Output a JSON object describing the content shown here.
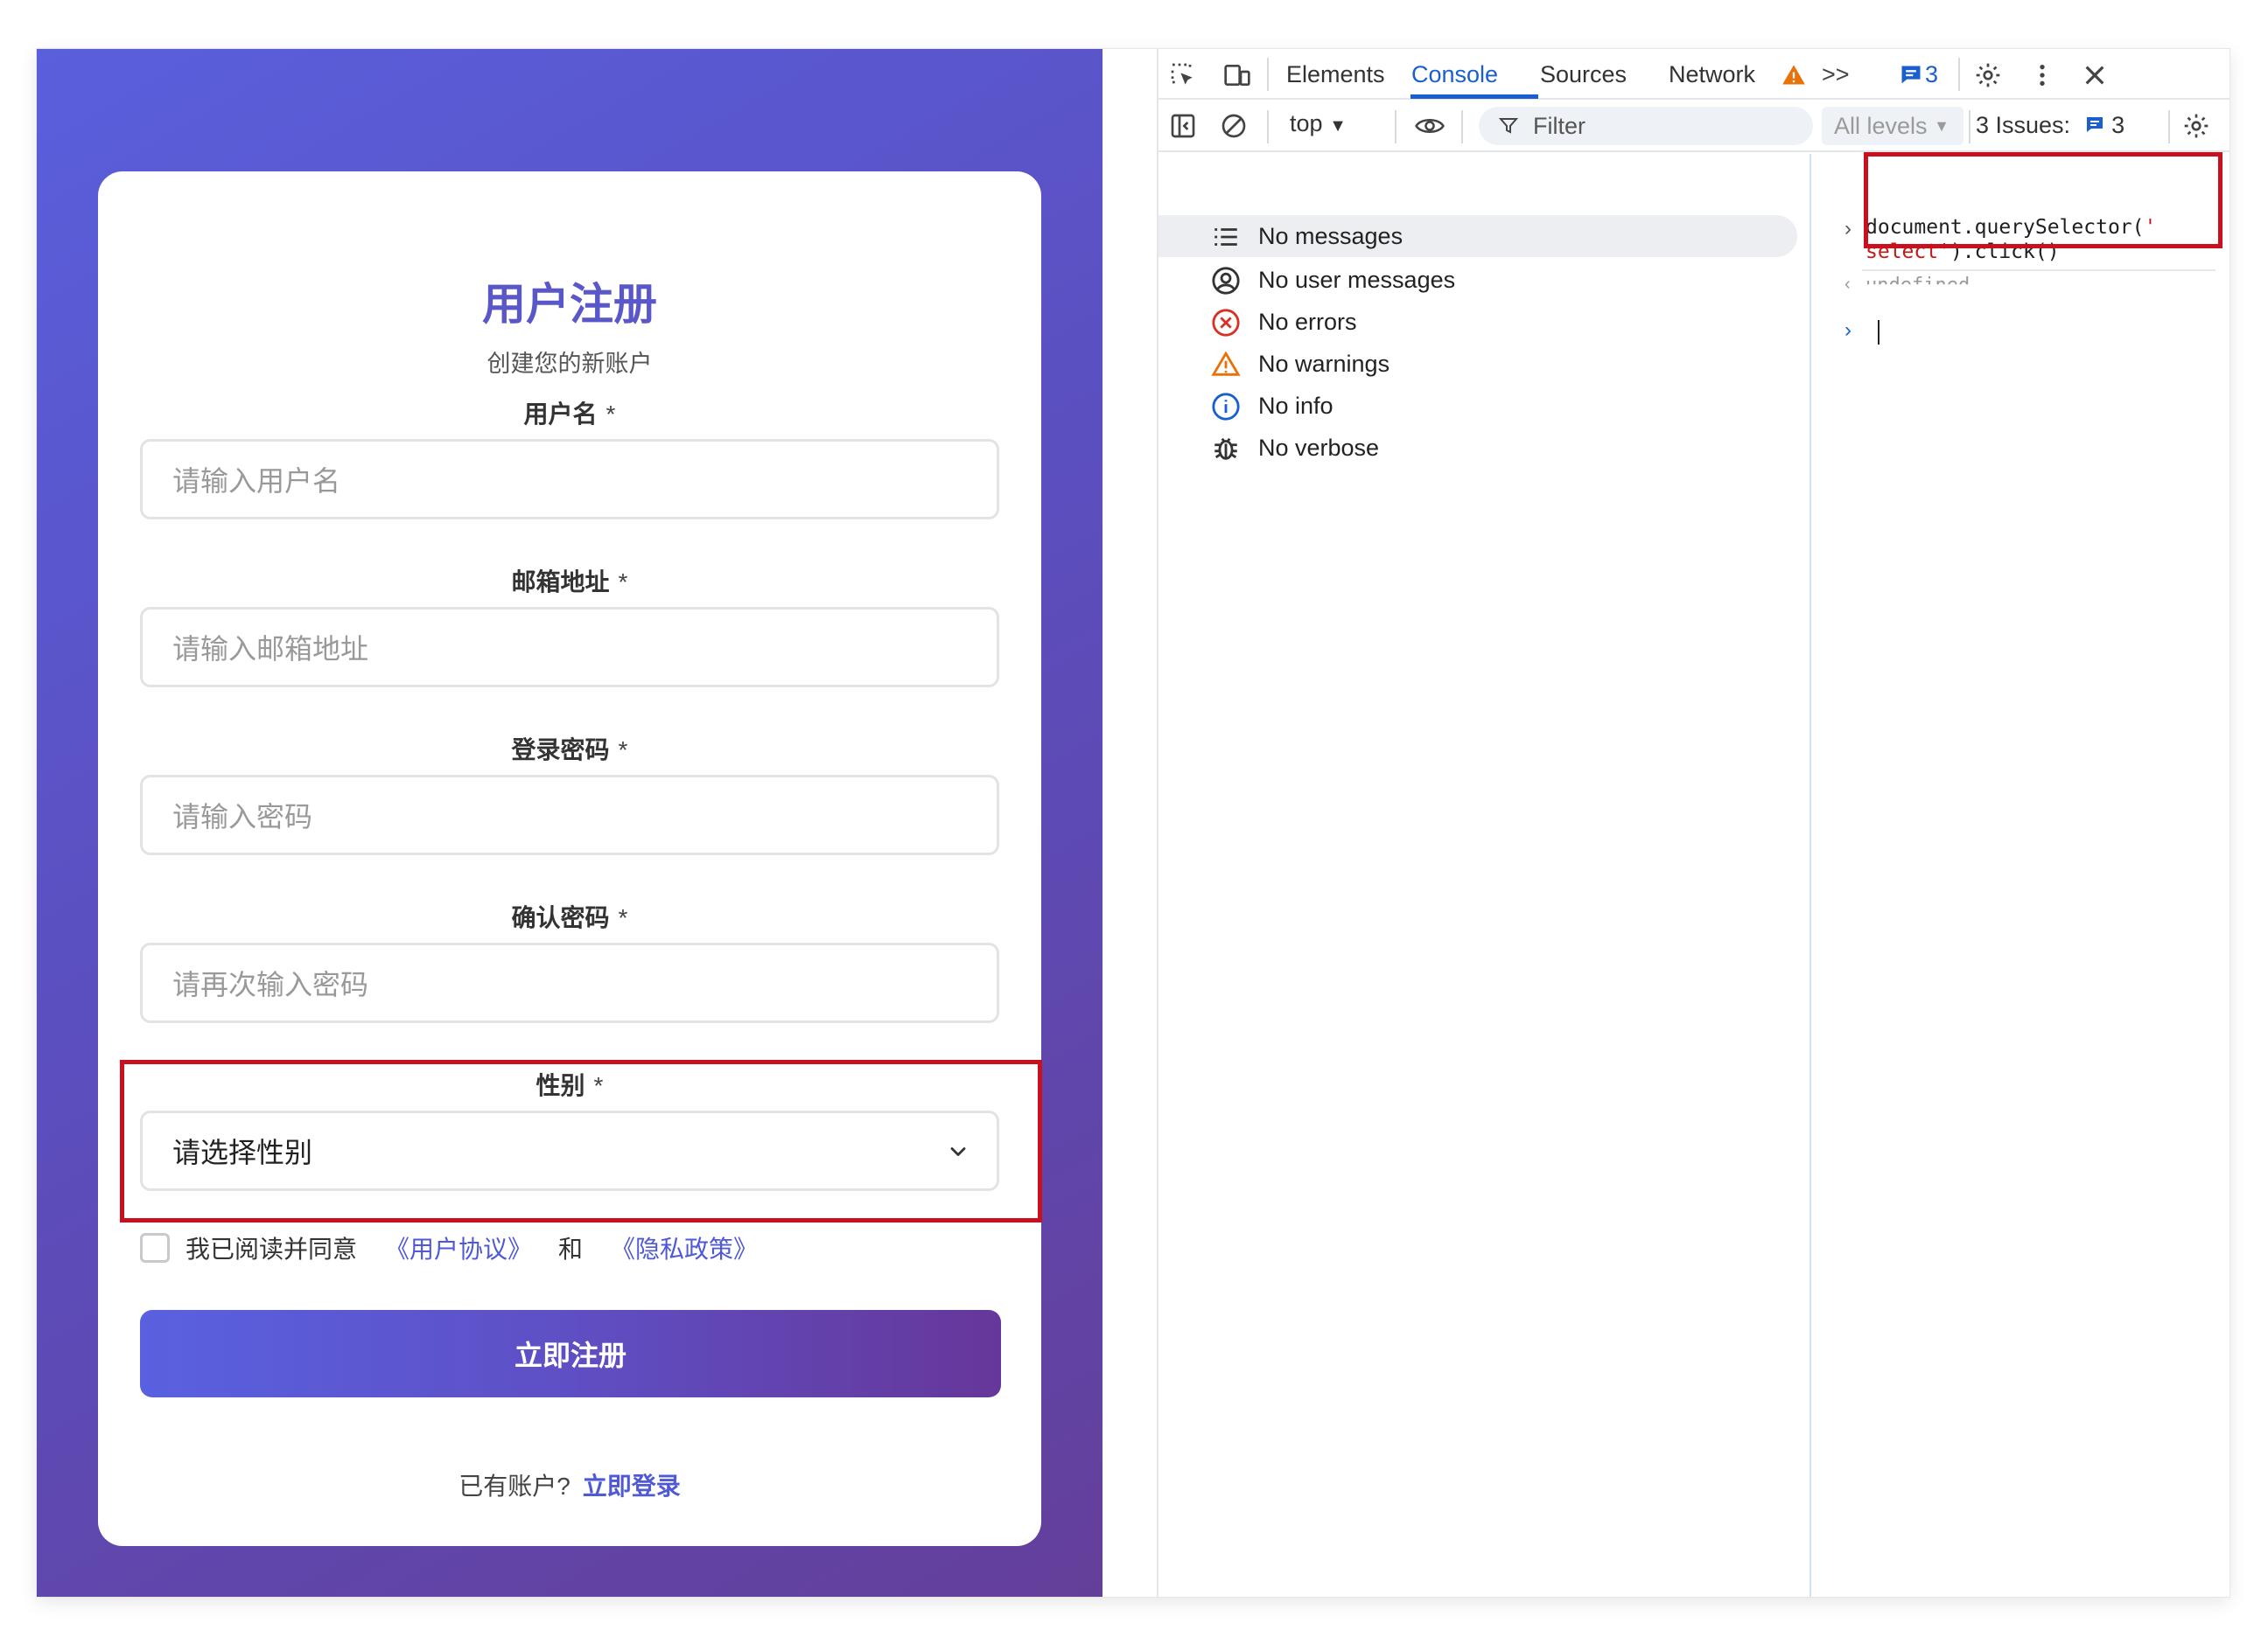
{
  "form": {
    "title": "用户注册",
    "subtitle": "创建您的新账户",
    "required_mark": "*",
    "fields": [
      {
        "label": "用户名",
        "placeholder": "请输入用户名"
      },
      {
        "label": "邮箱地址",
        "placeholder": "请输入邮箱地址"
      },
      {
        "label": "登录密码",
        "placeholder": "请输入密码"
      },
      {
        "label": "确认密码",
        "placeholder": "请再次输入密码"
      }
    ],
    "gender": {
      "label": "性别",
      "selected": "请选择性别"
    },
    "agree": {
      "prefix": "我已阅读并同意",
      "link1": "《用户协议》",
      "and": "和",
      "link2": "《隐私政策》"
    },
    "submit_label": "立即注册",
    "login": {
      "prompt": "已有账户?",
      "link": "立即登录"
    }
  },
  "devtools": {
    "tabs": [
      "Elements",
      "Console",
      "Sources",
      "Network"
    ],
    "active_tab": "Console",
    "more_tabs": ">>",
    "message_badge": "3",
    "context": "top",
    "filter_placeholder": "Filter",
    "levels": "All levels",
    "issues_label": "3 Issues:",
    "issues_count": "3",
    "sidebar": [
      {
        "label": "No messages",
        "icon": "list-icon"
      },
      {
        "label": "No user messages",
        "icon": "user-icon"
      },
      {
        "label": "No errors",
        "icon": "error-icon"
      },
      {
        "label": "No warnings",
        "icon": "warning-icon"
      },
      {
        "label": "No info",
        "icon": "info-icon"
      },
      {
        "label": "No verbose",
        "icon": "bug-icon"
      }
    ],
    "console": {
      "cmd_line1_a": "document.querySelector(",
      "cmd_line1_b": "'",
      "cmd_line2_a": "select'",
      "cmd_line2_b": ").click()",
      "result": "undefined"
    },
    "colors": {
      "accent": "#1a5fd0",
      "highlight": "#c8101e",
      "error": "#d93025",
      "warning": "#e8710a"
    }
  }
}
